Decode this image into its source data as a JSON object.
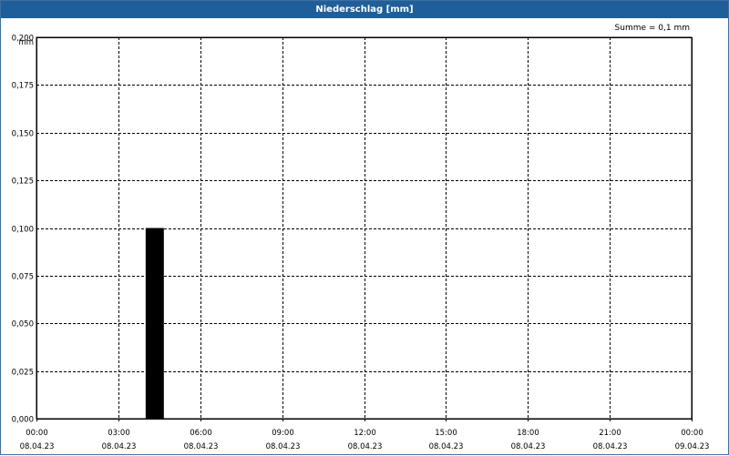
{
  "window": {
    "title": "Niederschlag [mm]"
  },
  "summary": "Summe = 0,1 mm",
  "colors": {
    "titlebar": "#1f5f99",
    "bar": "#000000",
    "grid": "#000000"
  },
  "chart_data": {
    "type": "bar",
    "title": "Niederschlag [mm]",
    "ylabel": "mm",
    "ylim": [
      0,
      0.2
    ],
    "yticks": [
      "0,000",
      "0,025",
      "0,050",
      "0,075",
      "0,100",
      "0,125",
      "0,150",
      "0,175",
      "0,200"
    ],
    "xlim_hours": [
      0,
      24
    ],
    "xticks": [
      {
        "time": "00:00",
        "date": "08.04.23"
      },
      {
        "time": "03:00",
        "date": "08.04.23"
      },
      {
        "time": "06:00",
        "date": "08.04.23"
      },
      {
        "time": "09:00",
        "date": "08.04.23"
      },
      {
        "time": "12:00",
        "date": "08.04.23"
      },
      {
        "time": "15:00",
        "date": "08.04.23"
      },
      {
        "time": "18:00",
        "date": "08.04.23"
      },
      {
        "time": "21:00",
        "date": "08.04.23"
      },
      {
        "time": "00:00",
        "date": "09.04.23"
      }
    ],
    "bars": [
      {
        "start": "08.04.23 04:00",
        "end": "08.04.23 04:40",
        "value": 0.1
      }
    ],
    "grid": true
  }
}
